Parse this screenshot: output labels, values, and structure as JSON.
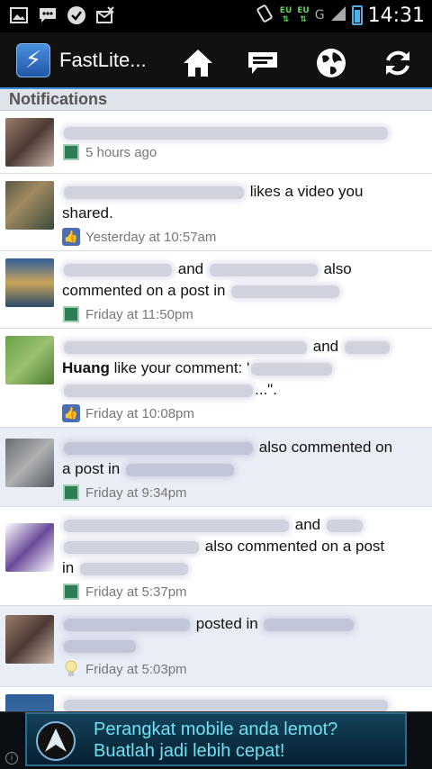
{
  "status_bar": {
    "time": "14:31",
    "carrier_1": "EU",
    "carrier_2": "EU",
    "carrier_1b": "⇅",
    "carrier_2b": "⇅",
    "network": "G"
  },
  "app_bar": {
    "title": "FastLite...",
    "logo_glyph": "⚡",
    "icons": [
      "home-icon",
      "messages-icon",
      "globe-icon",
      "refresh-icon"
    ]
  },
  "section": {
    "title": "Notifications"
  },
  "notifications": [
    {
      "text_parts": [
        "",
        ""
      ],
      "time": "5 hours ago",
      "icon": "group-icon"
    },
    {
      "text_parts": [
        "likes a video you",
        "shared."
      ],
      "time": "Yesterday at 10:57am",
      "icon": "like-icon"
    },
    {
      "text_parts": [
        "and",
        "also",
        "commented on a post in"
      ],
      "time": "Friday at 11:50pm",
      "icon": "group-icon"
    },
    {
      "text_parts": [
        "and",
        "Huang",
        "like your comment: '",
        "...\"."
      ],
      "time": "Friday at 10:08pm",
      "icon": "like-icon"
    },
    {
      "text_parts": [
        "also commented on",
        "a post in"
      ],
      "time": "Friday at 9:34pm",
      "icon": "group-icon"
    },
    {
      "text_parts": [
        "and",
        "also commented on a post",
        "in"
      ],
      "time": "Friday at 5:37pm",
      "icon": "group-icon"
    },
    {
      "text_parts": [
        "posted in"
      ],
      "time": "Friday at 5:03pm",
      "icon": "bulb-icon"
    }
  ],
  "ad": {
    "line1": "Perangkat mobile anda lemot?",
    "line2": "Buatlah jadi lebih cepat!",
    "info": "i"
  },
  "colors": {
    "accent": "#3c8ed6",
    "ad_text": "#6fe0f2",
    "alt_row": "#e9edf6"
  }
}
